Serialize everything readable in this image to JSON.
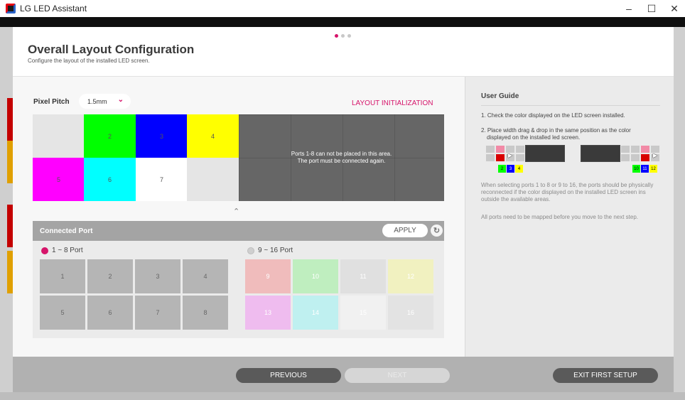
{
  "window": {
    "title": "LG LED Assistant",
    "min_symbol": "–",
    "max_symbol": "☐",
    "close_symbol": "✕"
  },
  "wizard": {
    "steps": 3,
    "current_step": 1
  },
  "header": {
    "title": "Overall Layout Configuration",
    "subtitle": "Configure the layout of the installed LED screen."
  },
  "pixel_pitch": {
    "label": "Pixel Pitch",
    "value": "1.5mm"
  },
  "layout_init_label": "LAYOUT INITIALIZATION",
  "layout_grid": {
    "cells": [
      {
        "label": "",
        "color": "#e5e5e5"
      },
      {
        "label": "2",
        "color": "#00ff00"
      },
      {
        "label": "3",
        "color": "#0000ff"
      },
      {
        "label": "4",
        "color": "#ffff00"
      },
      {
        "label": "5",
        "color": "#ff00ff"
      },
      {
        "label": "6",
        "color": "#00ffff"
      },
      {
        "label": "7",
        "color": "#ffffff"
      },
      {
        "label": "",
        "color": "#e5e5e5"
      }
    ],
    "blocked_line1": "Ports 1-8 can not be placed in this area.",
    "blocked_line2": "The port must be connected again."
  },
  "connected_port": {
    "title": "Connected Port",
    "apply_label": "APPLY",
    "group1_label": "1 ~ 8 Port",
    "group2_label": "9 ~ 16 Port",
    "ports1": [
      {
        "label": "1",
        "color": "#b5b5b5"
      },
      {
        "label": "2",
        "color": "#b5b5b5"
      },
      {
        "label": "3",
        "color": "#b5b5b5"
      },
      {
        "label": "4",
        "color": "#b5b5b5"
      },
      {
        "label": "5",
        "color": "#b5b5b5"
      },
      {
        "label": "6",
        "color": "#b5b5b5"
      },
      {
        "label": "7",
        "color": "#b5b5b5"
      },
      {
        "label": "8",
        "color": "#b5b5b5"
      }
    ],
    "ports2": [
      {
        "label": "9",
        "color": "#f0bcbc"
      },
      {
        "label": "10",
        "color": "#bfeebf"
      },
      {
        "label": "11",
        "color": "#e0e0e0"
      },
      {
        "label": "12",
        "color": "#f1f1c0"
      },
      {
        "label": "13",
        "color": "#efbcef"
      },
      {
        "label": "14",
        "color": "#bff0f0"
      },
      {
        "label": "15",
        "color": "#f1f1f1"
      },
      {
        "label": "16",
        "color": "#e3e3e3"
      }
    ]
  },
  "user_guide": {
    "title": "User Guide",
    "step1": "1. Check the color displayed on the LED screen installed.",
    "step2_line1": "2. Place width drag & drop in the same position as the color",
    "step2_line2": "displayed on the installed led screen.",
    "example_left_tags": [
      "2",
      "3",
      "4"
    ],
    "example_right_tags": [
      "10",
      "11",
      "12"
    ],
    "note1": "When selecting ports 1 to 8 or 9 to 16, the ports should be physically reconnected if the color displayed on the installed LED screen ins outside the available areas.",
    "note2": "All ports need to be mapped before you move to the next step."
  },
  "footer": {
    "previous_label": "PREVIOUS",
    "next_label": "NEXT",
    "exit_label": "EXIT FIRST SETUP"
  },
  "colors": {
    "accent": "#d6146a",
    "dark_button": "#5a5a5a",
    "blocked_area": "#666666"
  }
}
